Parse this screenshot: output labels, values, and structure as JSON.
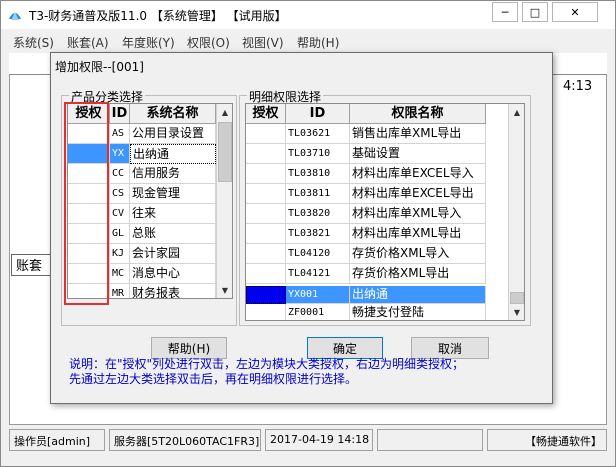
{
  "main_window": {
    "title": "T3-财务通普及版11.0 【系统管理】 【试用版】",
    "menu": [
      "系统(S)",
      "账套(A)",
      "年度账(Y)",
      "权限(O)",
      "视图(V)",
      "帮助(H)"
    ],
    "window_buttons": {
      "minimize": "─",
      "maximize": "□",
      "close": "✕"
    },
    "bg_time_fragment": "4:13",
    "bg_label_fragment": "账套"
  },
  "statusbar": {
    "operator": "操作员[admin]",
    "server": "服务器[5T20L060TAC1FR3]",
    "datetime": "2017-04-19 14:18",
    "brand": "【畅捷通软件】"
  },
  "dialog": {
    "title": "增加权限--[001]",
    "left_group": {
      "label": "产品分类选择",
      "headers": [
        "授权",
        "ID",
        "系统名称"
      ],
      "rows": [
        {
          "id": "AS",
          "name": "公用目录设置"
        },
        {
          "id": "YX",
          "name": "出纳通"
        },
        {
          "id": "CC",
          "name": "信用服务"
        },
        {
          "id": "CS",
          "name": "现金管理"
        },
        {
          "id": "CV",
          "name": "往来"
        },
        {
          "id": "GL",
          "name": "总账"
        },
        {
          "id": "KJ",
          "name": "会计家园"
        },
        {
          "id": "MC",
          "name": "消息中心"
        },
        {
          "id": "MR",
          "name": "财务报表"
        }
      ]
    },
    "right_group": {
      "label": "明细权限选择",
      "headers": [
        "授权",
        "ID",
        "权限名称"
      ],
      "rows": [
        {
          "id": "TL03621",
          "name": "销售出库单XML导出"
        },
        {
          "id": "TL03710",
          "name": "基础设置"
        },
        {
          "id": "TL03810",
          "name": "材料出库单EXCEL导入"
        },
        {
          "id": "TL03811",
          "name": "材料出库单EXCEL导出"
        },
        {
          "id": "TL03820",
          "name": "材料出库单XML导入"
        },
        {
          "id": "TL03821",
          "name": "材料出库单XML导出"
        },
        {
          "id": "TL04120",
          "name": "存货价格XML导入"
        },
        {
          "id": "TL04121",
          "name": "存货价格XML导出"
        },
        {
          "id": "YX001",
          "name": "出纳通"
        },
        {
          "id": "ZF0001",
          "name": "畅捷支付登陆"
        }
      ]
    },
    "buttons": {
      "help": "帮助(H)",
      "ok": "确定",
      "cancel": "取消"
    },
    "note_line1": "说明：在\"授权\"列处进行双击，左边为模块大类授权，右边为明细类授权；",
    "note_line2": "先通过左边大类选择双击后，再在明细权限进行选择。"
  },
  "colors": {
    "selection": "#3d96ff",
    "selection_dark": "#0000ee",
    "highlight_box": "#e03030",
    "note_text": "#0000cc"
  }
}
